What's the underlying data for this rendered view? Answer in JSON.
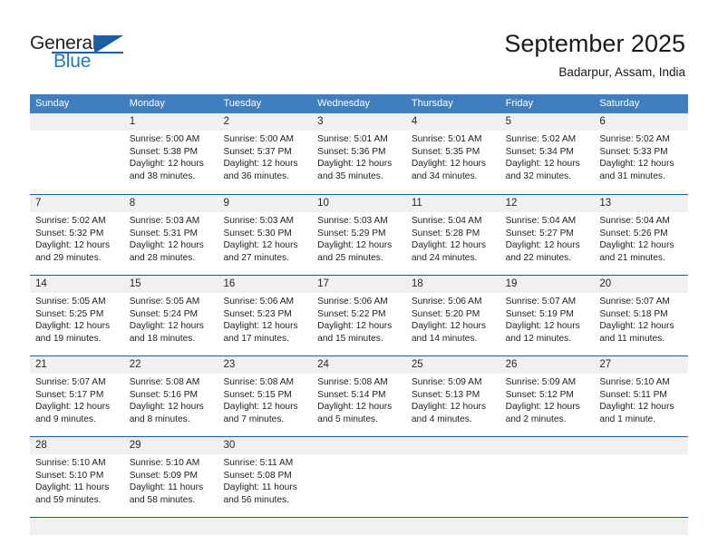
{
  "brand": {
    "word1": "General",
    "word2": "Blue",
    "logo_icon": "general-blue-triangle-logo"
  },
  "header": {
    "title": "September 2025",
    "subtitle": "Badarpur, Assam, India"
  },
  "theme": {
    "header_blue": "#3f7fbf",
    "rule_blue": "#1560a8",
    "daynum_band": "#f0f0f0",
    "brand_blue": "#1f7ac0"
  },
  "calendar": {
    "day_names": [
      "Sunday",
      "Monday",
      "Tuesday",
      "Wednesday",
      "Thursday",
      "Friday",
      "Saturday"
    ],
    "weeks": [
      [
        {
          "num": "",
          "lines": []
        },
        {
          "num": "1",
          "lines": [
            "Sunrise: 5:00 AM",
            "Sunset: 5:38 PM",
            "Daylight: 12 hours",
            "and 38 minutes."
          ]
        },
        {
          "num": "2",
          "lines": [
            "Sunrise: 5:00 AM",
            "Sunset: 5:37 PM",
            "Daylight: 12 hours",
            "and 36 minutes."
          ]
        },
        {
          "num": "3",
          "lines": [
            "Sunrise: 5:01 AM",
            "Sunset: 5:36 PM",
            "Daylight: 12 hours",
            "and 35 minutes."
          ]
        },
        {
          "num": "4",
          "lines": [
            "Sunrise: 5:01 AM",
            "Sunset: 5:35 PM",
            "Daylight: 12 hours",
            "and 34 minutes."
          ]
        },
        {
          "num": "5",
          "lines": [
            "Sunrise: 5:02 AM",
            "Sunset: 5:34 PM",
            "Daylight: 12 hours",
            "and 32 minutes."
          ]
        },
        {
          "num": "6",
          "lines": [
            "Sunrise: 5:02 AM",
            "Sunset: 5:33 PM",
            "Daylight: 12 hours",
            "and 31 minutes."
          ]
        }
      ],
      [
        {
          "num": "7",
          "lines": [
            "Sunrise: 5:02 AM",
            "Sunset: 5:32 PM",
            "Daylight: 12 hours",
            "and 29 minutes."
          ]
        },
        {
          "num": "8",
          "lines": [
            "Sunrise: 5:03 AM",
            "Sunset: 5:31 PM",
            "Daylight: 12 hours",
            "and 28 minutes."
          ]
        },
        {
          "num": "9",
          "lines": [
            "Sunrise: 5:03 AM",
            "Sunset: 5:30 PM",
            "Daylight: 12 hours",
            "and 27 minutes."
          ]
        },
        {
          "num": "10",
          "lines": [
            "Sunrise: 5:03 AM",
            "Sunset: 5:29 PM",
            "Daylight: 12 hours",
            "and 25 minutes."
          ]
        },
        {
          "num": "11",
          "lines": [
            "Sunrise: 5:04 AM",
            "Sunset: 5:28 PM",
            "Daylight: 12 hours",
            "and 24 minutes."
          ]
        },
        {
          "num": "12",
          "lines": [
            "Sunrise: 5:04 AM",
            "Sunset: 5:27 PM",
            "Daylight: 12 hours",
            "and 22 minutes."
          ]
        },
        {
          "num": "13",
          "lines": [
            "Sunrise: 5:04 AM",
            "Sunset: 5:26 PM",
            "Daylight: 12 hours",
            "and 21 minutes."
          ]
        }
      ],
      [
        {
          "num": "14",
          "lines": [
            "Sunrise: 5:05 AM",
            "Sunset: 5:25 PM",
            "Daylight: 12 hours",
            "and 19 minutes."
          ]
        },
        {
          "num": "15",
          "lines": [
            "Sunrise: 5:05 AM",
            "Sunset: 5:24 PM",
            "Daylight: 12 hours",
            "and 18 minutes."
          ]
        },
        {
          "num": "16",
          "lines": [
            "Sunrise: 5:06 AM",
            "Sunset: 5:23 PM",
            "Daylight: 12 hours",
            "and 17 minutes."
          ]
        },
        {
          "num": "17",
          "lines": [
            "Sunrise: 5:06 AM",
            "Sunset: 5:22 PM",
            "Daylight: 12 hours",
            "and 15 minutes."
          ]
        },
        {
          "num": "18",
          "lines": [
            "Sunrise: 5:06 AM",
            "Sunset: 5:20 PM",
            "Daylight: 12 hours",
            "and 14 minutes."
          ]
        },
        {
          "num": "19",
          "lines": [
            "Sunrise: 5:07 AM",
            "Sunset: 5:19 PM",
            "Daylight: 12 hours",
            "and 12 minutes."
          ]
        },
        {
          "num": "20",
          "lines": [
            "Sunrise: 5:07 AM",
            "Sunset: 5:18 PM",
            "Daylight: 12 hours",
            "and 11 minutes."
          ]
        }
      ],
      [
        {
          "num": "21",
          "lines": [
            "Sunrise: 5:07 AM",
            "Sunset: 5:17 PM",
            "Daylight: 12 hours",
            "and 9 minutes."
          ]
        },
        {
          "num": "22",
          "lines": [
            "Sunrise: 5:08 AM",
            "Sunset: 5:16 PM",
            "Daylight: 12 hours",
            "and 8 minutes."
          ]
        },
        {
          "num": "23",
          "lines": [
            "Sunrise: 5:08 AM",
            "Sunset: 5:15 PM",
            "Daylight: 12 hours",
            "and 7 minutes."
          ]
        },
        {
          "num": "24",
          "lines": [
            "Sunrise: 5:08 AM",
            "Sunset: 5:14 PM",
            "Daylight: 12 hours",
            "and 5 minutes."
          ]
        },
        {
          "num": "25",
          "lines": [
            "Sunrise: 5:09 AM",
            "Sunset: 5:13 PM",
            "Daylight: 12 hours",
            "and 4 minutes."
          ]
        },
        {
          "num": "26",
          "lines": [
            "Sunrise: 5:09 AM",
            "Sunset: 5:12 PM",
            "Daylight: 12 hours",
            "and 2 minutes."
          ]
        },
        {
          "num": "27",
          "lines": [
            "Sunrise: 5:10 AM",
            "Sunset: 5:11 PM",
            "Daylight: 12 hours",
            "and 1 minute."
          ]
        }
      ],
      [
        {
          "num": "28",
          "lines": [
            "Sunrise: 5:10 AM",
            "Sunset: 5:10 PM",
            "Daylight: 11 hours",
            "and 59 minutes."
          ]
        },
        {
          "num": "29",
          "lines": [
            "Sunrise: 5:10 AM",
            "Sunset: 5:09 PM",
            "Daylight: 11 hours",
            "and 58 minutes."
          ]
        },
        {
          "num": "30",
          "lines": [
            "Sunrise: 5:11 AM",
            "Sunset: 5:08 PM",
            "Daylight: 11 hours",
            "and 56 minutes."
          ]
        },
        {
          "num": "",
          "lines": []
        },
        {
          "num": "",
          "lines": []
        },
        {
          "num": "",
          "lines": []
        },
        {
          "num": "",
          "lines": []
        }
      ]
    ]
  }
}
